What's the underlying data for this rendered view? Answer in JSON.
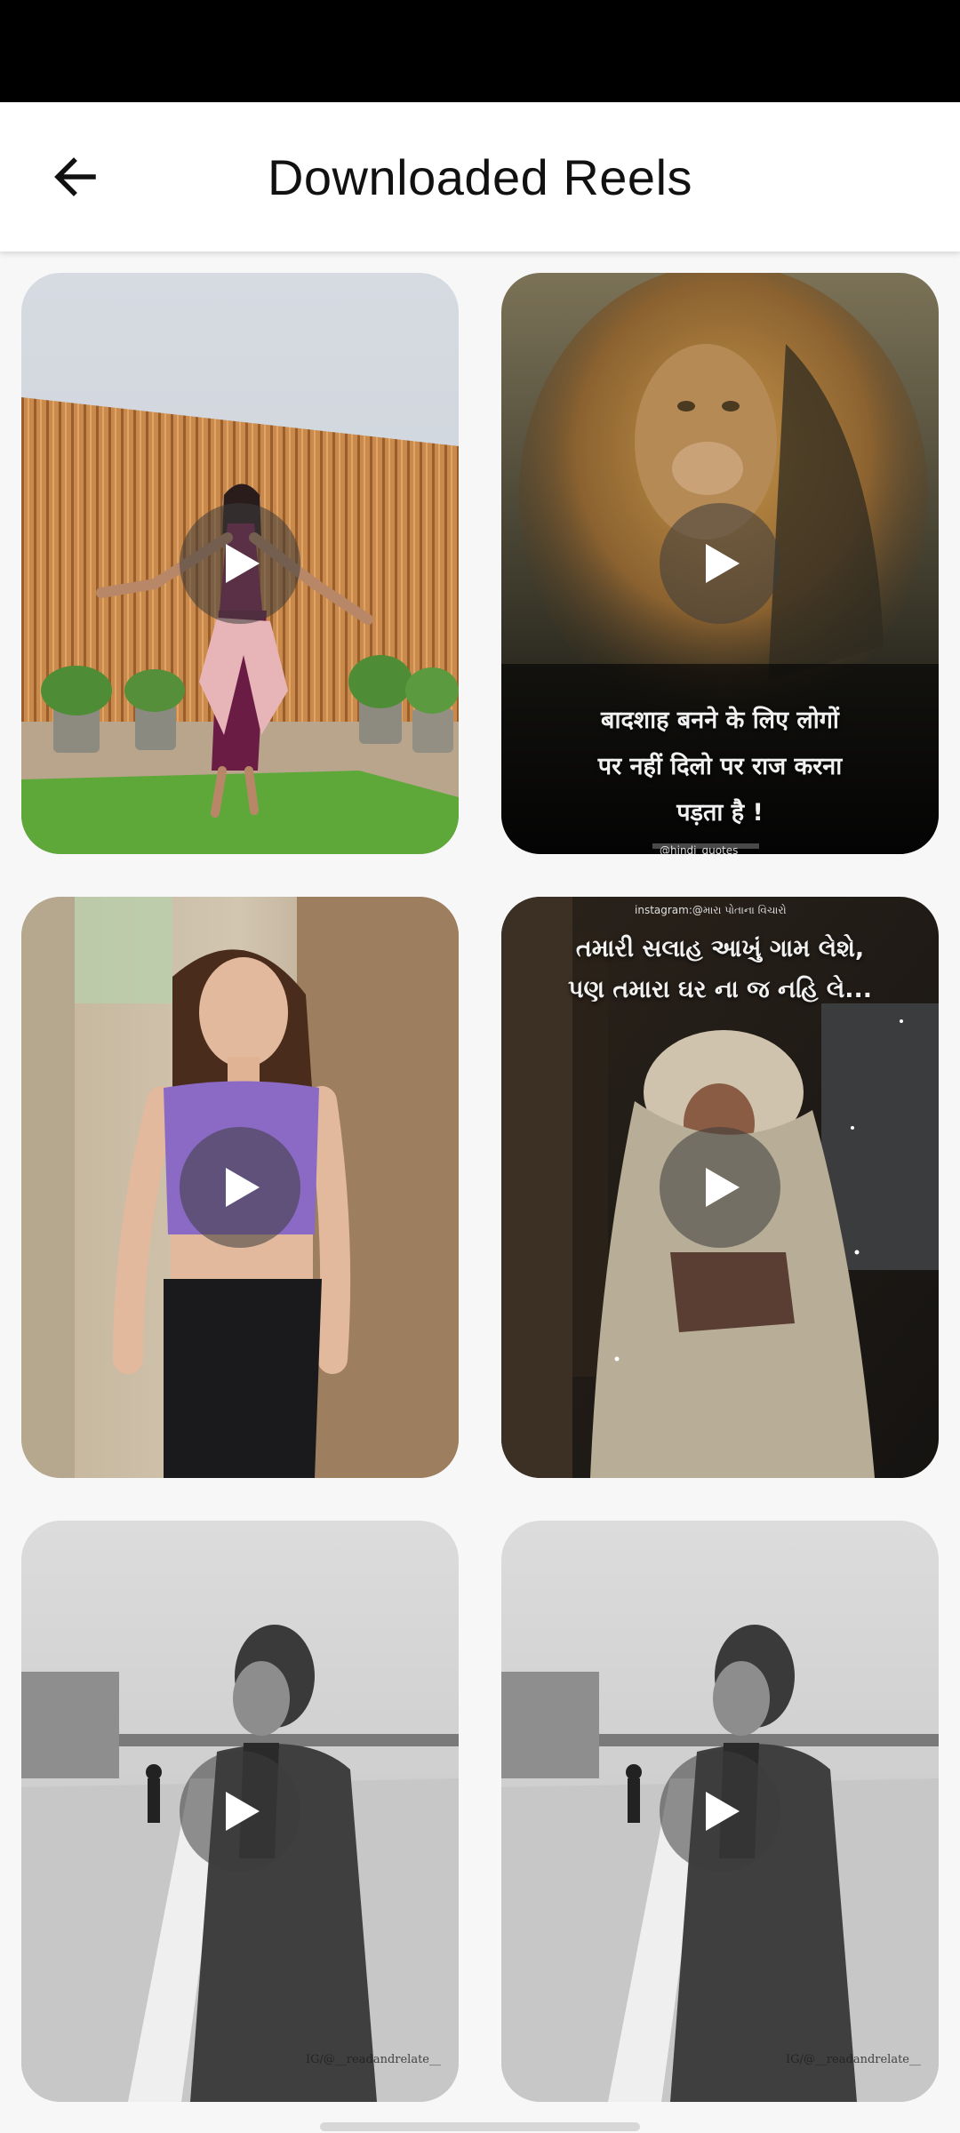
{
  "app_bar": {
    "title": "Downloaded Reels",
    "back_icon": "arrow-left-icon"
  },
  "reels": [
    {
      "id": "dancer",
      "play_icon": "play-icon"
    },
    {
      "id": "lion",
      "play_icon": "play-icon",
      "caption_lines": [
        "बादशाह बनने के लिए लोगों",
        "पर नहीं दिलो पर राज करना",
        "पड़ता है !"
      ],
      "tag": "@hindi_quotes"
    },
    {
      "id": "model",
      "play_icon": "play-icon"
    },
    {
      "id": "old-man",
      "play_icon": "play-icon",
      "tag": "instagram:@મારા પોતાના વિચારો",
      "caption_lines": [
        "તમારી સલાહ આખું ગામ લેશે,",
        "પણ તમારા ઘર ના જ નહિ લે..."
      ]
    },
    {
      "id": "man-coat-1",
      "play_icon": "play-icon",
      "watermark": "IG/@__readandrelate__"
    },
    {
      "id": "man-coat-2",
      "play_icon": "play-icon",
      "watermark": "IG/@__readandrelate__"
    }
  ],
  "colors": {
    "status_bar": "#000000",
    "app_bar": "#ffffff",
    "background": "#f7f7f8",
    "play_overlay": "rgba(60,60,60,0.55)"
  }
}
